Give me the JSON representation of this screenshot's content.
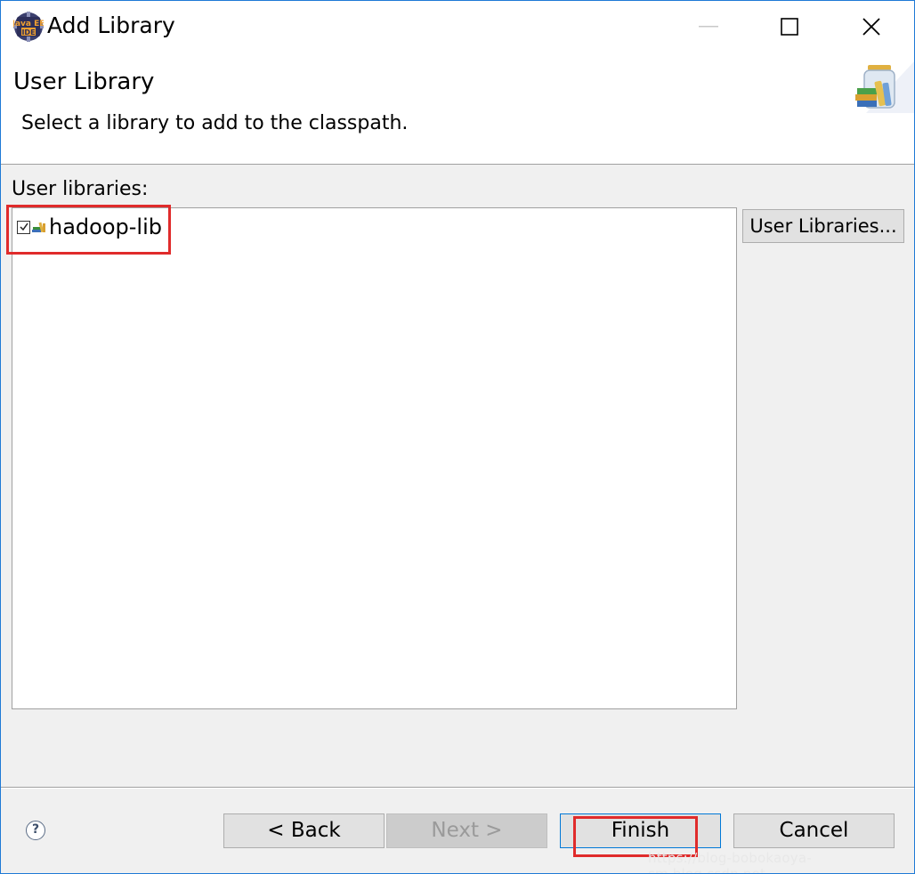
{
  "window": {
    "title": "Add Library",
    "app_icon_label": "Java EE IDE"
  },
  "banner": {
    "title": "User Library",
    "description": "Select a library to add to the classpath."
  },
  "library_list": {
    "label": "User libraries:",
    "items": [
      {
        "name": "hadoop-lib",
        "checked": true
      }
    ]
  },
  "side_button": {
    "label": "User Libraries..."
  },
  "footer": {
    "help_label": "?",
    "back_label": "< Back",
    "next_label": "Next >",
    "finish_label": "Finish",
    "cancel_label": "Cancel"
  },
  "watermark": "https://blog-bobokaoya-sm.blog.csdn.net",
  "colors": {
    "accent": "#0078d7",
    "highlight": "#e02b2b",
    "window_border": "#1f7ad6"
  }
}
